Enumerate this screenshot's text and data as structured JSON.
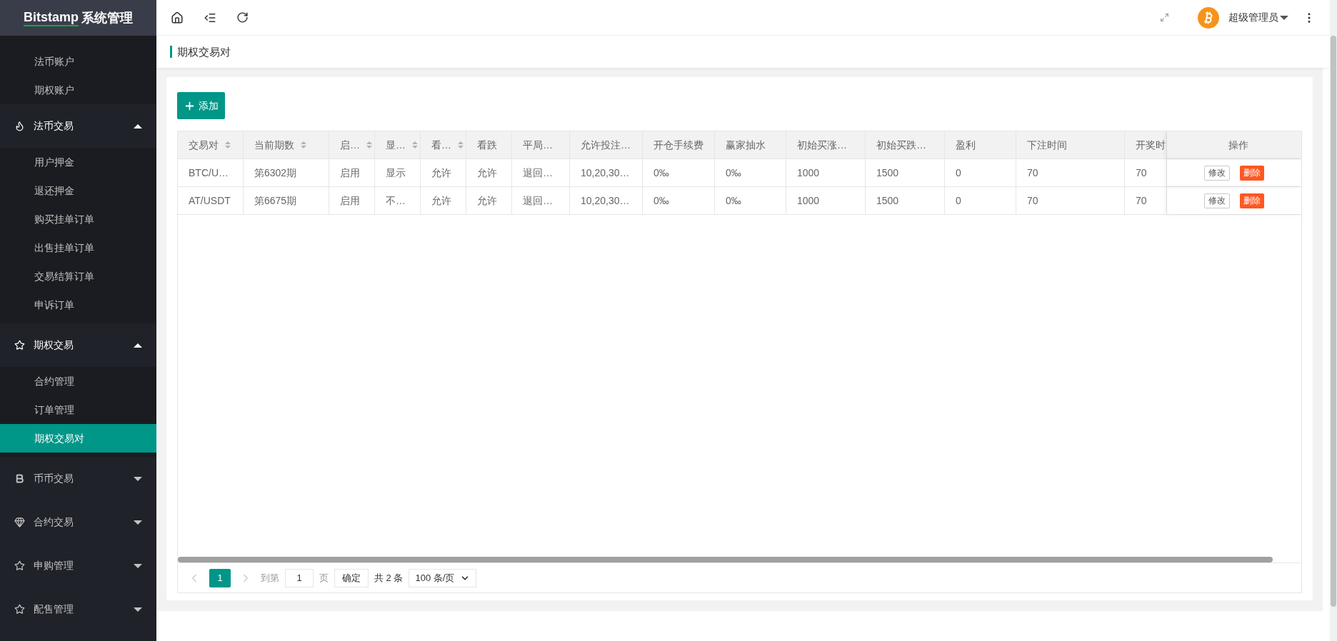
{
  "logo": {
    "brand": "Bitstamp",
    "title": "系统管理"
  },
  "sidebar": [
    {
      "kind": "item",
      "label": "法币账户",
      "selected": false
    },
    {
      "kind": "item",
      "label": "期权账户",
      "selected": false
    },
    {
      "kind": "section",
      "label": "法币交易",
      "expanded": true,
      "children": [
        {
          "label": "用户押金",
          "selected": false
        },
        {
          "label": "退还押金",
          "selected": false
        },
        {
          "label": "购买挂单订单",
          "selected": false
        },
        {
          "label": "出售挂单订单",
          "selected": false
        },
        {
          "label": "交易结算订单",
          "selected": false
        },
        {
          "label": "申诉订单",
          "selected": false
        }
      ]
    },
    {
      "kind": "section",
      "label": "期权交易",
      "expanded": true,
      "children": [
        {
          "label": "合约管理",
          "selected": false
        },
        {
          "label": "订单管理",
          "selected": false
        },
        {
          "label": "期权交易对",
          "selected": true
        }
      ]
    },
    {
      "kind": "section",
      "label": "币币交易",
      "expanded": false
    },
    {
      "kind": "section",
      "label": "合约交易",
      "expanded": false
    },
    {
      "kind": "section",
      "label": "申购管理",
      "expanded": false
    },
    {
      "kind": "section",
      "label": "配售管理",
      "expanded": false
    }
  ],
  "header": {
    "user": "超级管理员"
  },
  "breadcrumb": "期权交易对",
  "add_button": "添加",
  "table": {
    "columns": [
      {
        "label": "交易对",
        "sortable": true
      },
      {
        "label": "当前期数",
        "sortable": true
      },
      {
        "label": "启…",
        "sortable": true
      },
      {
        "label": "显…",
        "sortable": true
      },
      {
        "label": "看…",
        "sortable": true
      },
      {
        "label": "看跌",
        "sortable": false
      },
      {
        "label": "平局…",
        "sortable": false
      },
      {
        "label": "允许投注…",
        "sortable": false
      },
      {
        "label": "开仓手续费",
        "sortable": false
      },
      {
        "label": "赢家抽水",
        "sortable": false
      },
      {
        "label": "初始买涨…",
        "sortable": false
      },
      {
        "label": "初始买跌…",
        "sortable": false
      },
      {
        "label": "盈利",
        "sortable": false
      },
      {
        "label": "下注时间",
        "sortable": false
      },
      {
        "label": "开奖时",
        "sortable": false
      },
      {
        "label": "操作",
        "sortable": false
      }
    ],
    "rows": [
      {
        "cells": [
          "BTC/U…",
          "第6302期",
          "启用",
          "显示",
          "允许",
          "允许",
          "退回…",
          "10,20,30…",
          "0‰",
          "0‰",
          "1000",
          "1500",
          "0",
          "70",
          "70"
        ],
        "actions": [
          "修改",
          "删除"
        ]
      },
      {
        "cells": [
          "AT/USDT",
          "第6675期",
          "启用",
          "不…",
          "允许",
          "允许",
          "退回…",
          "10,20,30…",
          "0‰",
          "0‰",
          "1000",
          "1500",
          "0",
          "70",
          "70"
        ],
        "actions": [
          "修改",
          "删除"
        ]
      }
    ]
  },
  "pagination": {
    "pages": [
      {
        "label": "1",
        "selected": true
      }
    ],
    "goto_label": "到第",
    "goto_value": "1",
    "page_label": "页",
    "confirm": "确定",
    "total": "共 2 条",
    "page_size": "100 条/页"
  }
}
